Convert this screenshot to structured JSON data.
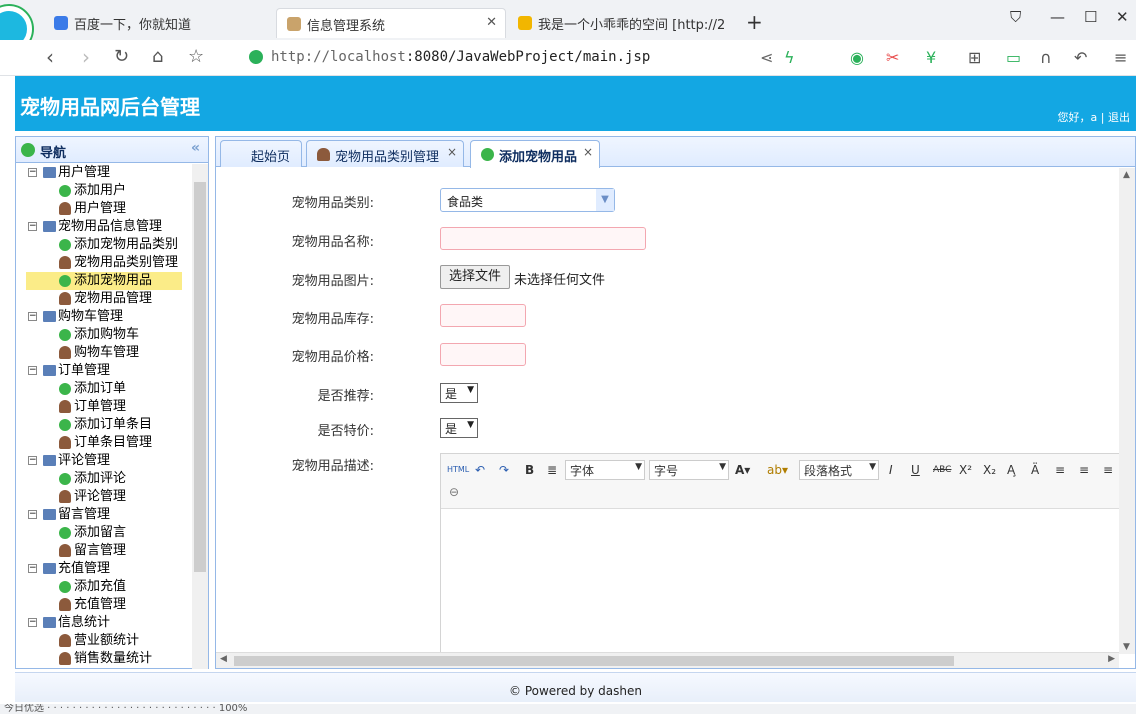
{
  "browser": {
    "tabs": [
      {
        "title": "百度一下，你就知道",
        "favicon_color": "#3b7be8"
      },
      {
        "title": "信息管理系统",
        "favicon_color": "#c9a36b",
        "active": true
      },
      {
        "title": "我是一个小乖乖的空间 [http://2",
        "favicon_color": "#f2b600"
      }
    ],
    "url_host": "http://localhost",
    "url_rest": ":8080/JavaWebProject/main.jsp"
  },
  "app": {
    "title": "宠物用品网后台管理",
    "welcome": "您好，a |",
    "logout": "退出"
  },
  "sidebar": {
    "title": "导航",
    "collapse_icon": "«",
    "groups": [
      {
        "label": "用户管理",
        "items": [
          "添加用户",
          "用户管理"
        ]
      },
      {
        "label": "宠物用品信息管理",
        "items": [
          "添加宠物用品类别",
          "宠物用品类别管理",
          "添加宠物用品",
          "宠物用品管理"
        ]
      },
      {
        "label": "购物车管理",
        "items": [
          "添加购物车",
          "购物车管理"
        ]
      },
      {
        "label": "订单管理",
        "items": [
          "添加订单",
          "订单管理",
          "添加订单条目",
          "订单条目管理"
        ]
      },
      {
        "label": "评论管理",
        "items": [
          "添加评论",
          "评论管理"
        ]
      },
      {
        "label": "留言管理",
        "items": [
          "添加留言",
          "留言管理"
        ]
      },
      {
        "label": "充值管理",
        "items": [
          "添加充值",
          "充值管理"
        ]
      },
      {
        "label": "信息统计",
        "items": [
          "营业额统计",
          "销售数量统计"
        ]
      }
    ],
    "selected": "添加宠物用品"
  },
  "content_tabs": [
    {
      "label": "起始页",
      "closable": false
    },
    {
      "label": "宠物用品类别管理",
      "closable": true
    },
    {
      "label": "添加宠物用品",
      "closable": true,
      "active": true
    }
  ],
  "form": {
    "category_label": "宠物用品类别:",
    "category_value": "食品类",
    "name_label": "宠物用品名称:",
    "name_value": "",
    "image_label": "宠物用品图片:",
    "file_button": "选择文件",
    "file_status": "未选择任何文件",
    "stock_label": "宠物用品库存:",
    "stock_value": "",
    "price_label": "宠物用品价格:",
    "price_value": "",
    "recommend_label": "是否推荐:",
    "recommend_value": "是",
    "special_label": "是否特价:",
    "special_value": "是",
    "desc_label": "宠物用品描述:"
  },
  "editor": {
    "font_family_placeholder": "字体",
    "font_size_placeholder": "字号",
    "paragraph_placeholder": "段落格式",
    "html_btn": "HTML",
    "bold": "B",
    "italic": "I",
    "underline": "U",
    "strike": "ABC",
    "sup": "X²",
    "sub": "X₂"
  },
  "footer": "© Powered by dashen",
  "statusbar": "今日优选    ·   ·    ·    ·    ·    ·    ·    ·    ·    ·    ·    ·    ·    ·    ·    ·    ·    ·    ·    ·    ·    ·    ·    ·    ·    ·    ·    100%",
  "colors": {
    "header": "#13a7e3",
    "panel_border": "#95b8e7",
    "selected_row": "#fbec88"
  }
}
